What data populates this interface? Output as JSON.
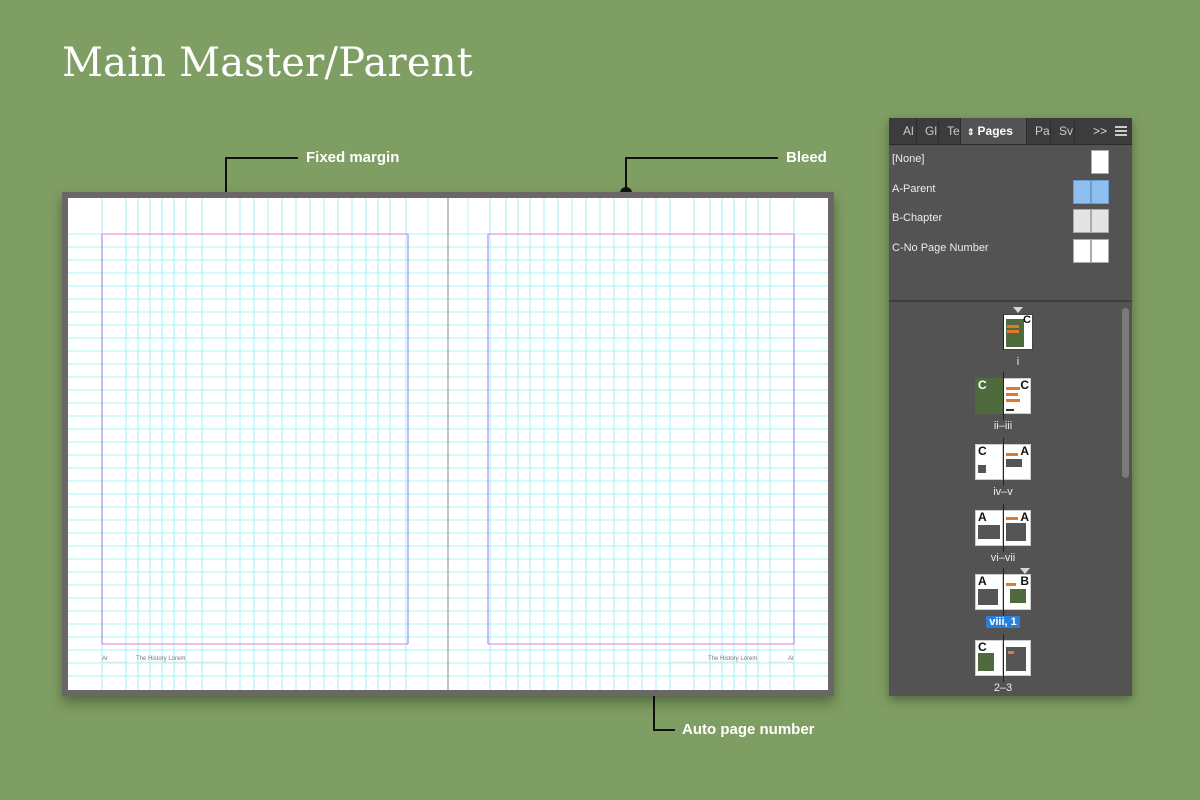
{
  "title": "Main Master/Parent",
  "callouts": {
    "fixed_margin": "Fixed margin",
    "bleed": "Bleed",
    "auto_page_number": "Auto page number"
  },
  "spread": {
    "left_footer_num": "Ar",
    "left_footer_title": "The History Lorem",
    "right_footer_title": "The History Lorem",
    "right_footer_num": "Ar"
  },
  "colors": {
    "background": "#7f9e63",
    "guide": "#8ff0f2",
    "margin": "#e679d6",
    "column": "#a98cf0",
    "panel": "#535353",
    "selection": "#2a7fd8"
  },
  "panel": {
    "tabs": [
      {
        "label": "Al",
        "active": false
      },
      {
        "label": "Gl",
        "active": false
      },
      {
        "label": "Te",
        "active": false
      },
      {
        "label": "Pages",
        "active": true
      },
      {
        "label": "Pa",
        "active": false
      },
      {
        "label": "Sv",
        "active": false
      }
    ],
    "more_icon": ">>",
    "parents": [
      {
        "label": "[None]",
        "thumb": "single-white"
      },
      {
        "label": "A-Parent",
        "thumb": "spread-selected"
      },
      {
        "label": "B-Chapter",
        "thumb": "spread-gray"
      },
      {
        "label": "C-No Page Number",
        "thumb": "spread-white"
      }
    ],
    "spreads": [
      {
        "label": "i",
        "left": "",
        "right": "C",
        "selected": false
      },
      {
        "label": "ii–iii",
        "left": "C",
        "right": "C",
        "selected": false
      },
      {
        "label": "iv–v",
        "left": "C",
        "right": "A",
        "selected": false
      },
      {
        "label": "vi–vii",
        "left": "A",
        "right": "A",
        "selected": false
      },
      {
        "label": "viii, 1",
        "left": "A",
        "right": "B",
        "selected": true
      },
      {
        "label": "2–3",
        "left": "C",
        "right": "",
        "selected": false
      }
    ]
  }
}
